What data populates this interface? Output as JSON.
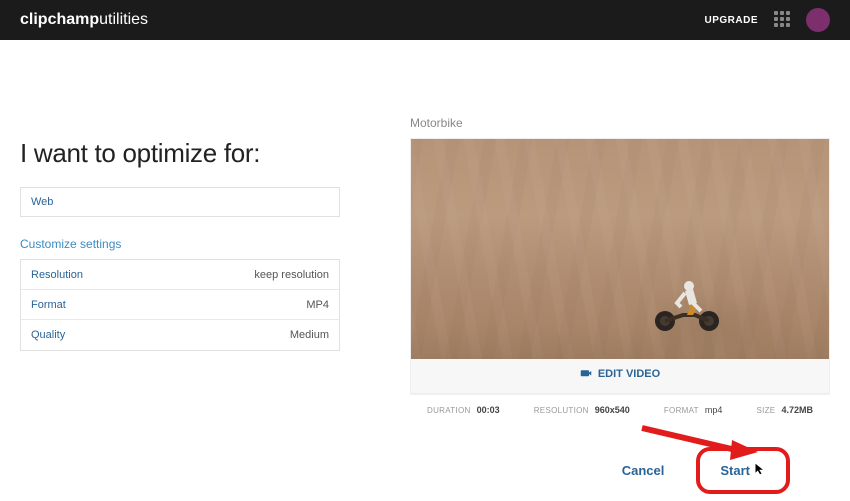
{
  "brand": {
    "bold": "clipchamp",
    "light": "utilities"
  },
  "header": {
    "upgrade": "UPGRADE"
  },
  "left_panel": {
    "title": "I want to optimize for:",
    "target": "Web",
    "customize_heading": "Customize settings",
    "settings": [
      {
        "label": "Resolution",
        "value": "keep resolution"
      },
      {
        "label": "Format",
        "value": "MP4"
      },
      {
        "label": "Quality",
        "value": "Medium"
      }
    ]
  },
  "video": {
    "name": "Motorbike",
    "edit_label": "EDIT VIDEO",
    "meta": {
      "duration_label": "DURATION",
      "duration": "00:03",
      "resolution_label": "RESOLUTION",
      "resolution": "960x540",
      "format_label": "FORMAT",
      "format": "mp4",
      "size_label": "SIZE",
      "size": "4.72MB"
    }
  },
  "actions": {
    "cancel": "Cancel",
    "start": "Start"
  }
}
